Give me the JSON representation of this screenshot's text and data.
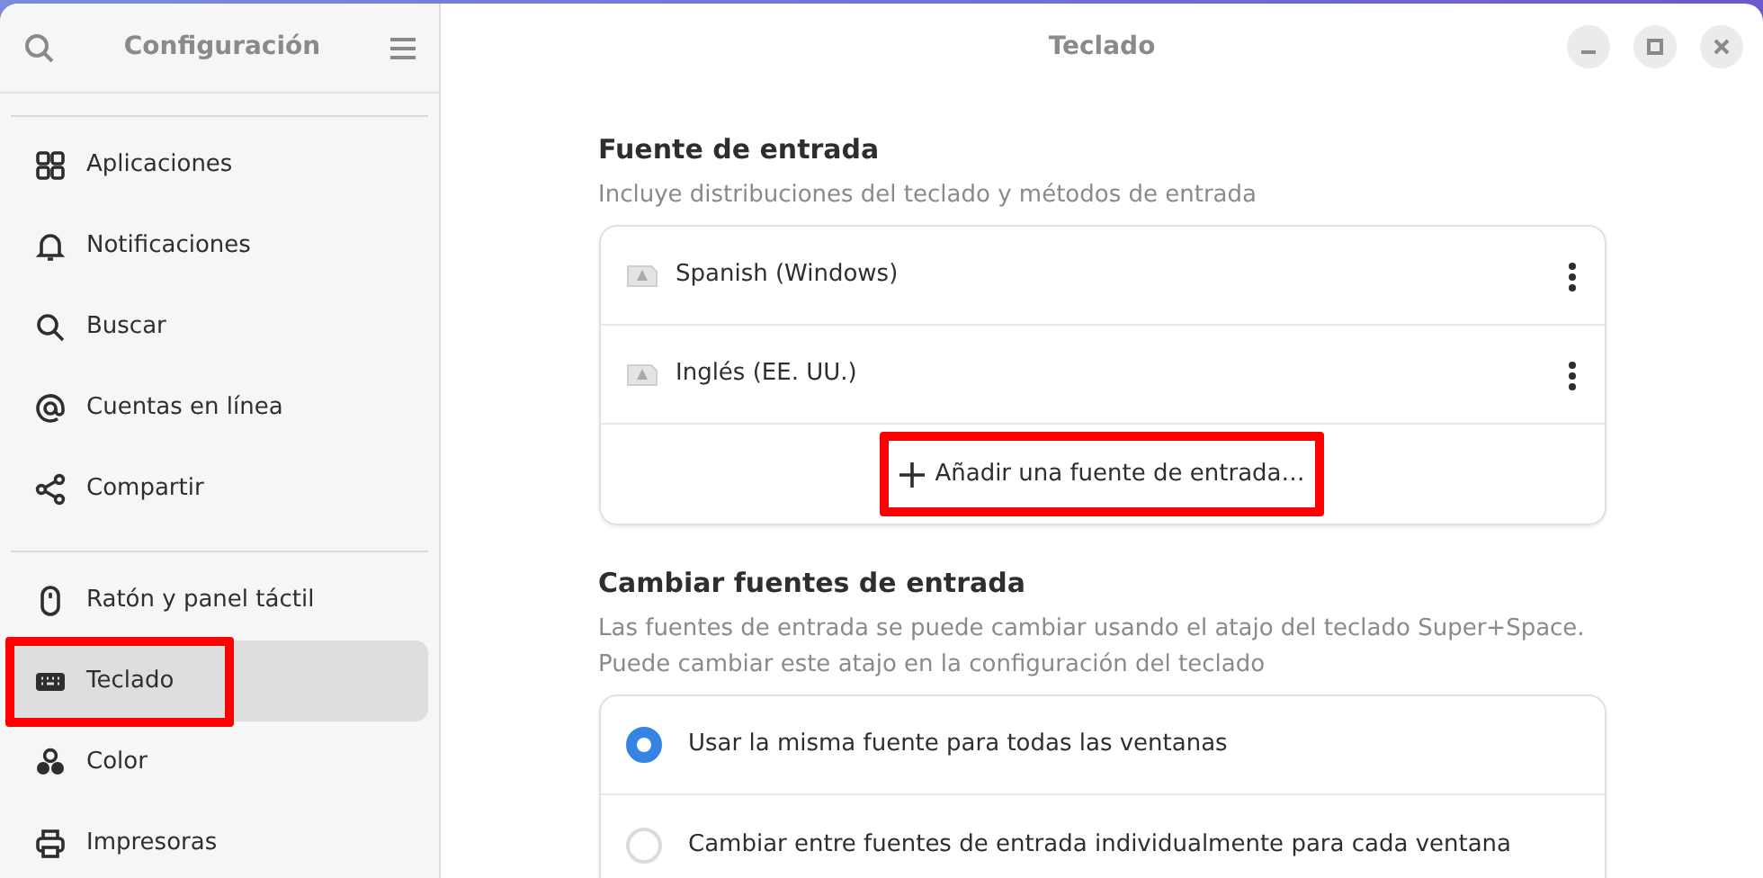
{
  "sidebar": {
    "title": "Configuración",
    "groups": [
      [
        {
          "label": "Aplicaciones",
          "selected": false,
          "highlighted": false
        },
        {
          "label": "Notificaciones",
          "selected": false,
          "highlighted": false
        },
        {
          "label": "Buscar",
          "selected": false,
          "highlighted": false
        },
        {
          "label": "Cuentas en línea",
          "selected": false,
          "highlighted": false
        },
        {
          "label": "Compartir",
          "selected": false,
          "highlighted": false
        }
      ],
      [
        {
          "label": "Ratón y panel táctil",
          "selected": false,
          "highlighted": false
        },
        {
          "label": "Teclado",
          "selected": true,
          "highlighted": true
        },
        {
          "label": "Color",
          "selected": false,
          "highlighted": false
        },
        {
          "label": "Impresoras",
          "selected": false,
          "highlighted": false
        }
      ]
    ]
  },
  "window": {
    "title": "Teclado"
  },
  "input_sources": {
    "title": "Fuente de entrada",
    "description": "Incluye distribuciones del teclado y métodos de entrada",
    "sources": [
      {
        "label": "Spanish (Windows)"
      },
      {
        "label": "Inglés (EE. UU.)"
      }
    ],
    "add_button": {
      "label": "Añadir una fuente de entrada…",
      "highlighted": true
    }
  },
  "switching": {
    "title": "Cambiar fuentes de entrada",
    "description": [
      "Las fuentes de entrada se puede cambiar usando el atajo del teclado Super+Space.",
      "Puede cambiar este atajo en la configuración del teclado"
    ],
    "options": [
      {
        "label": "Usar la misma fuente para todas las ventanas",
        "selected": true
      },
      {
        "label": "Cambiar entre fuentes de entrada individualmente para cada ventana",
        "selected": false
      }
    ]
  }
}
